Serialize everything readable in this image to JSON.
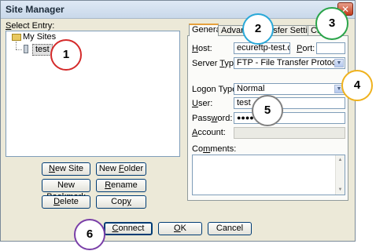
{
  "window": {
    "title": "Site Manager",
    "close_glyph": "✕"
  },
  "tree": {
    "heading_prefix": "",
    "heading_underlined": "S",
    "heading_rest": "elect Entry:",
    "root_label": "My Sites",
    "root_icon": "folder-icon",
    "site_label": "test",
    "site_icon": "site-icon"
  },
  "left_buttons": {
    "new_site": {
      "u": "N",
      "rest": "ew Site"
    },
    "new_folder": {
      "pre": "New ",
      "u": "F",
      "rest": "older"
    },
    "new_bookmark": {
      "pre": "New Bookm",
      "u": "a",
      "rest": "rk"
    },
    "rename": {
      "u": "R",
      "rest": "ename"
    },
    "delete": {
      "u": "D",
      "rest": "elete"
    },
    "copy": {
      "pre": "Cop",
      "u": "y",
      "rest": ""
    }
  },
  "tabs": [
    "General",
    "Advanced",
    "Transfer Settings",
    "Charset"
  ],
  "form": {
    "host": {
      "label_u": "H",
      "label_rest": "ost:",
      "value": "ecureftp-test.com"
    },
    "port": {
      "label_u": "P",
      "label_rest": "ort:",
      "value": ""
    },
    "server_type": {
      "label_pre": "Server ",
      "label_u": "T",
      "label_rest": "ype:",
      "value": "FTP - File Transfer Protocol"
    },
    "logon_type": {
      "label_pre": "Logon Type:",
      "value": "Normal"
    },
    "user": {
      "label_u": "U",
      "label_rest": "ser:",
      "value": "test"
    },
    "password": {
      "label_pre": "Pass",
      "label_u": "w",
      "label_rest": "ord:",
      "value": "●●●●"
    },
    "account": {
      "label_u": "A",
      "label_rest": "ccount:",
      "value": ""
    },
    "comments": {
      "label_pre": "Co",
      "label_u": "m",
      "label_rest": "ments:"
    }
  },
  "bottom_buttons": {
    "connect": {
      "u": "C",
      "rest": "onnect"
    },
    "ok": {
      "u": "O",
      "rest": "K"
    },
    "cancel": {
      "label": "Cancel"
    }
  },
  "callouts": [
    {
      "number": "1",
      "color": "#d42a2a"
    },
    {
      "number": "2",
      "color": "#29a8d8"
    },
    {
      "number": "3",
      "color": "#2aa44a"
    },
    {
      "number": "4",
      "color": "#efb21e"
    },
    {
      "number": "5",
      "color": "#808080"
    },
    {
      "number": "6",
      "color": "#7a3fa8"
    }
  ]
}
